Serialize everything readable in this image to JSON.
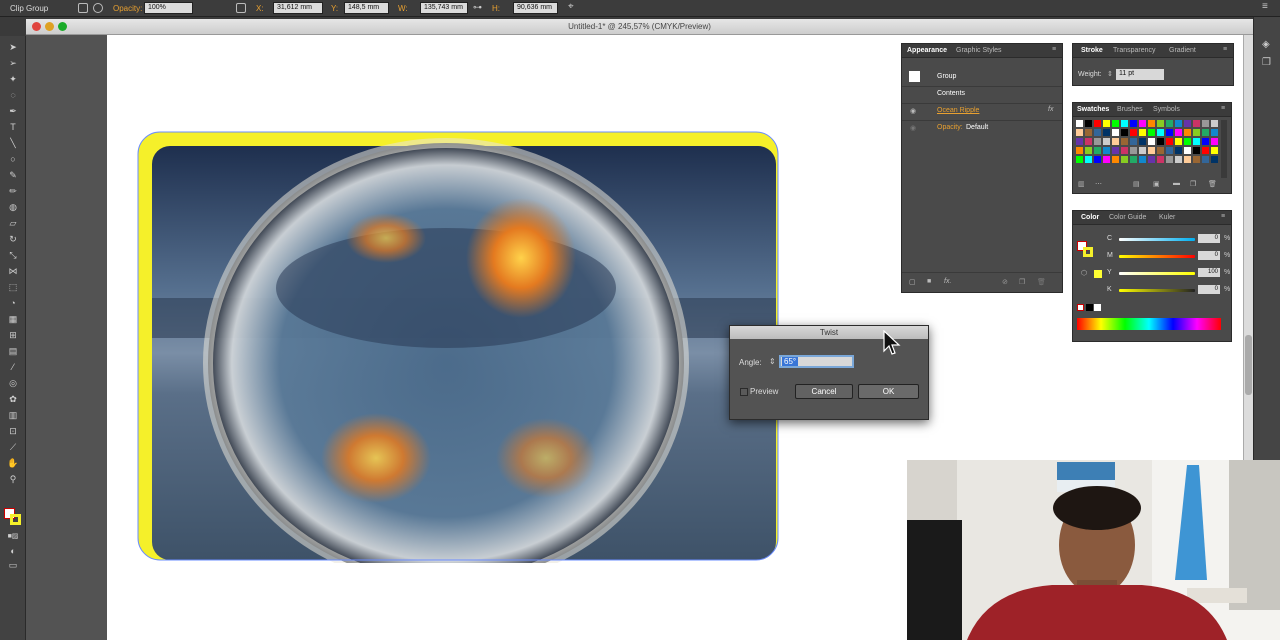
{
  "control_bar": {
    "selection_label": "Clip Group",
    "opacity_label": "Opacity:",
    "opacity_value": "100%",
    "x_label": "X:",
    "x_value": "31,612 mm",
    "y_label": "Y:",
    "y_value": "148,5 mm",
    "w_label": "W:",
    "w_value": "135,743 mm",
    "h_label": "H:",
    "h_value": "90,636 mm"
  },
  "document": {
    "title": "Untitled-1* @ 245,57% (CMYK/Preview)"
  },
  "appearance_panel": {
    "tabs": [
      "Appearance",
      "Graphic Styles"
    ],
    "object_type": "Group",
    "contents_label": "Contents",
    "effect_name": "Ocean Ripple",
    "effect_fx": "fx",
    "opacity_label": "Opacity:",
    "opacity_value": "Default",
    "footer_fx": "fx."
  },
  "stroke_panel": {
    "tabs": [
      "Stroke",
      "Transparency",
      "Gradient"
    ],
    "weight_label": "Weight:",
    "weight_value": "11 pt"
  },
  "swatches_panel": {
    "tabs": [
      "Swatches",
      "Brushes",
      "Symbols"
    ],
    "colors": [
      "#ffffff",
      "#000000",
      "#ff0000",
      "#ffff00",
      "#00ff00",
      "#00ffff",
      "#0000ff",
      "#ff00ff",
      "#ff8800",
      "#88cc22",
      "#22aa66",
      "#1188cc",
      "#6633aa",
      "#cc3366",
      "#999999",
      "#cccccc",
      "#ffcc99",
      "#996633",
      "#336699",
      "#003366"
    ]
  },
  "color_panel": {
    "tabs": [
      "Color",
      "Color Guide",
      "Kuler"
    ],
    "channels": [
      {
        "label": "C",
        "value": "0",
        "unit": "%"
      },
      {
        "label": "M",
        "value": "0",
        "unit": "%"
      },
      {
        "label": "Y",
        "value": "100",
        "unit": "%"
      },
      {
        "label": "K",
        "value": "0",
        "unit": "%"
      }
    ],
    "fill_color": "#ffff33"
  },
  "twist_dialog": {
    "title": "Twist",
    "angle_label": "Angle:",
    "angle_value": "65°",
    "preview_label": "Preview",
    "cancel_label": "Cancel",
    "ok_label": "OK"
  },
  "colors": {
    "highlight_yellow": "#f5f02a",
    "accent_orange": "#e8a030"
  }
}
